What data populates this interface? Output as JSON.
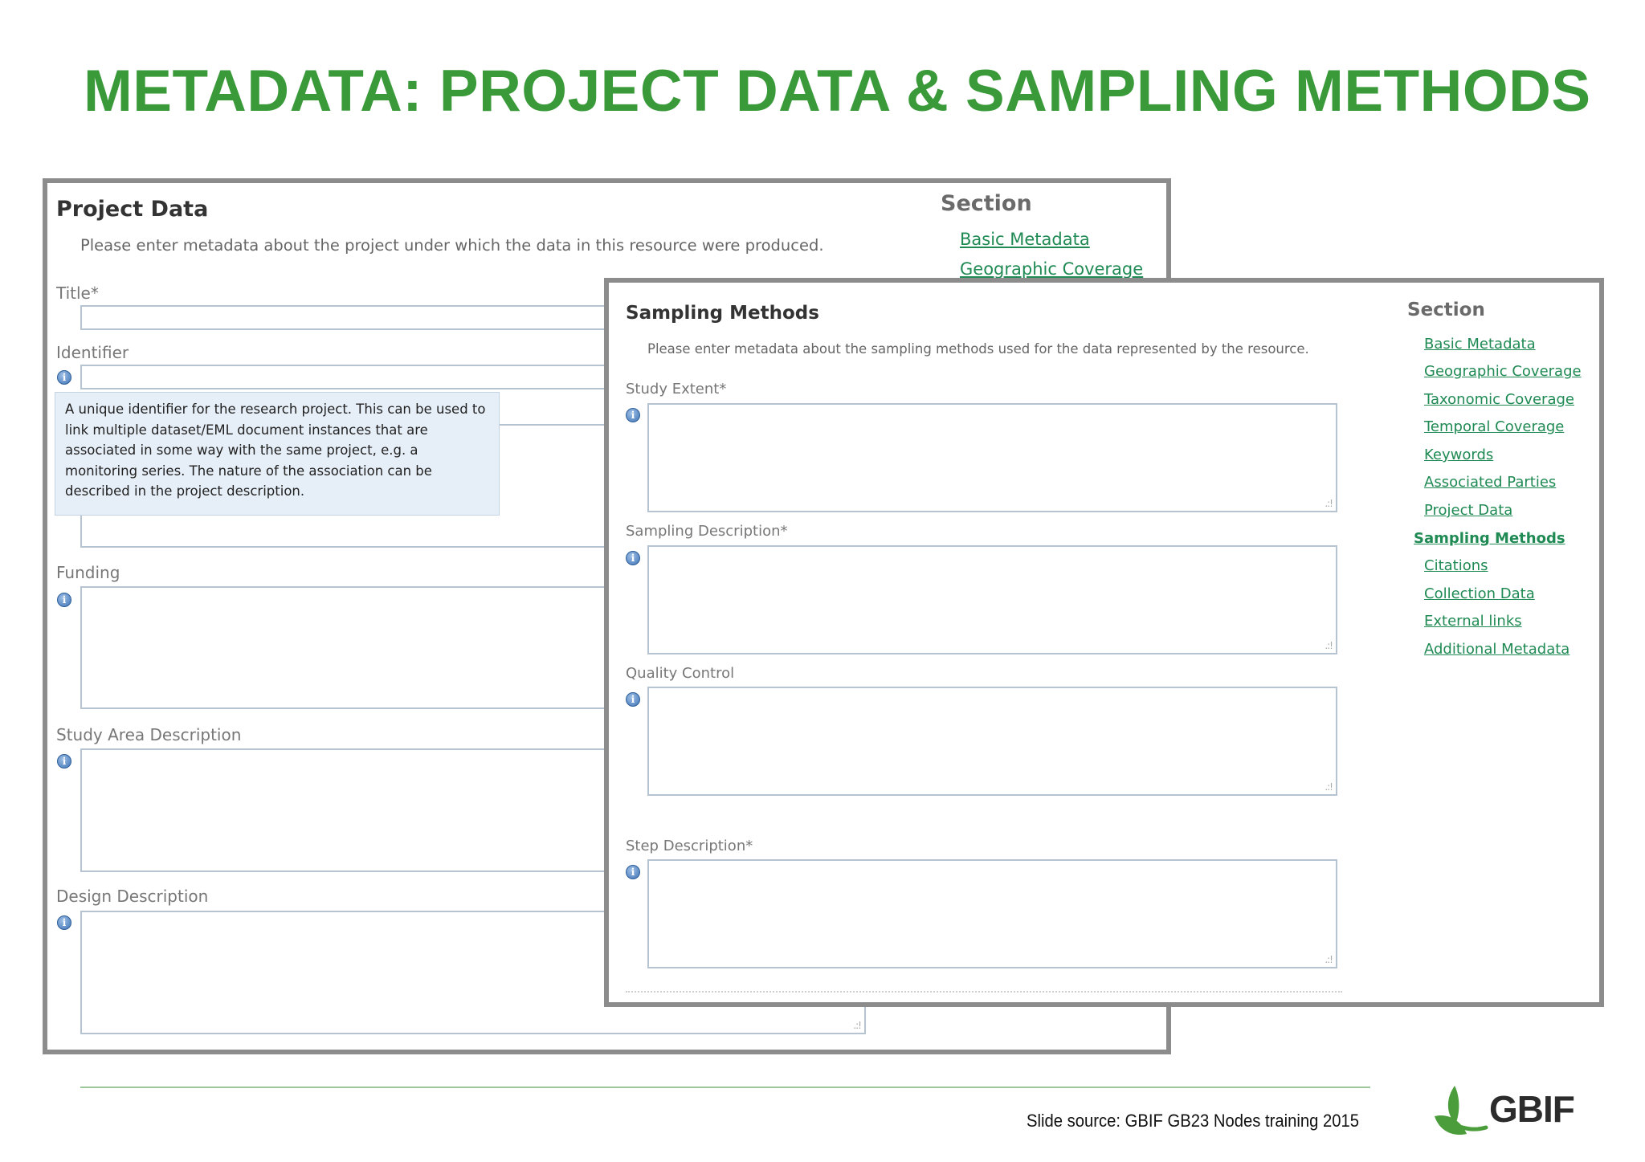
{
  "slide": {
    "title": "METADATA: PROJECT DATA & SAMPLING METHODS",
    "footer_source": "Slide source: GBIF GB23 Nodes training 2015",
    "logo_text": "GBIF",
    "title_color": "#3a9a3a",
    "link_color": "#1f8a53"
  },
  "project_panel": {
    "heading": "Project Data",
    "intro": "Please enter metadata about the project under which the data in this resource were produced.",
    "fields": [
      {
        "label": "Title*"
      },
      {
        "label": "Identifier"
      },
      {
        "label": "Funding"
      },
      {
        "label": "Study Area Description"
      },
      {
        "label": "Design Description"
      }
    ],
    "tooltip": "A unique identifier for the research project. This can be used to link multiple dataset/EML document instances that are associated in some way with the same project, e.g. a monitoring series. The nature of the association can be described in the project description.",
    "section_heading": "Section",
    "section_links": [
      "Basic Metadata",
      "Geographic Coverage"
    ]
  },
  "sampling_panel": {
    "heading": "Sampling Methods",
    "intro": "Please enter metadata about the sampling methods used for the data represented by the resource.",
    "fields": [
      {
        "label": "Study Extent*"
      },
      {
        "label": "Sampling Description*"
      },
      {
        "label": "Quality Control"
      },
      {
        "label": "Step Description*"
      }
    ],
    "section_heading": "Section",
    "section_links": [
      "Basic Metadata",
      "Geographic Coverage",
      "Taxonomic Coverage",
      "Temporal Coverage",
      "Keywords",
      "Associated Parties",
      "Project Data",
      "Sampling Methods",
      "Citations",
      "Collection Data",
      "External links",
      "Additional Metadata"
    ],
    "active_section": "Sampling Methods"
  }
}
